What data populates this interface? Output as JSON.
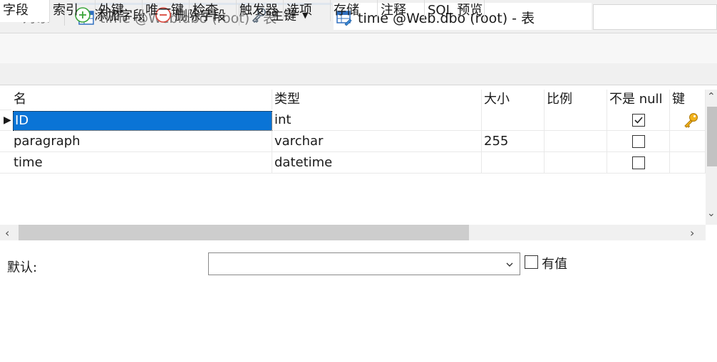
{
  "tabs": {
    "objects": "对象",
    "tab1": "time @Web.dbo (root) - 表",
    "tab2": "time @Web.dbo (root) - 表"
  },
  "toolbar": {
    "save": "保存",
    "add_field": "添加字段",
    "delete_field": "删除字段",
    "primary_key": "主键"
  },
  "inner_tabs": [
    "字段",
    "索引",
    "外键",
    "唯一键",
    "检查",
    "触发器",
    "选项",
    "存储",
    "注释",
    "SQL 预览"
  ],
  "grid": {
    "headers": [
      "名",
      "类型",
      "大小",
      "比例",
      "不是 null",
      "键"
    ],
    "rows": [
      {
        "name": "ID",
        "type": "int",
        "size": "",
        "scale": "",
        "not_null": true,
        "key": true
      },
      {
        "name": "paragraph",
        "type": "varchar",
        "size": "255",
        "scale": "",
        "not_null": false,
        "key": false
      },
      {
        "name": "time",
        "type": "datetime",
        "size": "",
        "scale": "",
        "not_null": false,
        "key": false
      }
    ]
  },
  "bottom": {
    "default_label": "默认:",
    "default_value": "",
    "has_value_label": "有值"
  },
  "colors": {
    "selection": "#0a74d6",
    "key_icon": "#e8a317"
  }
}
